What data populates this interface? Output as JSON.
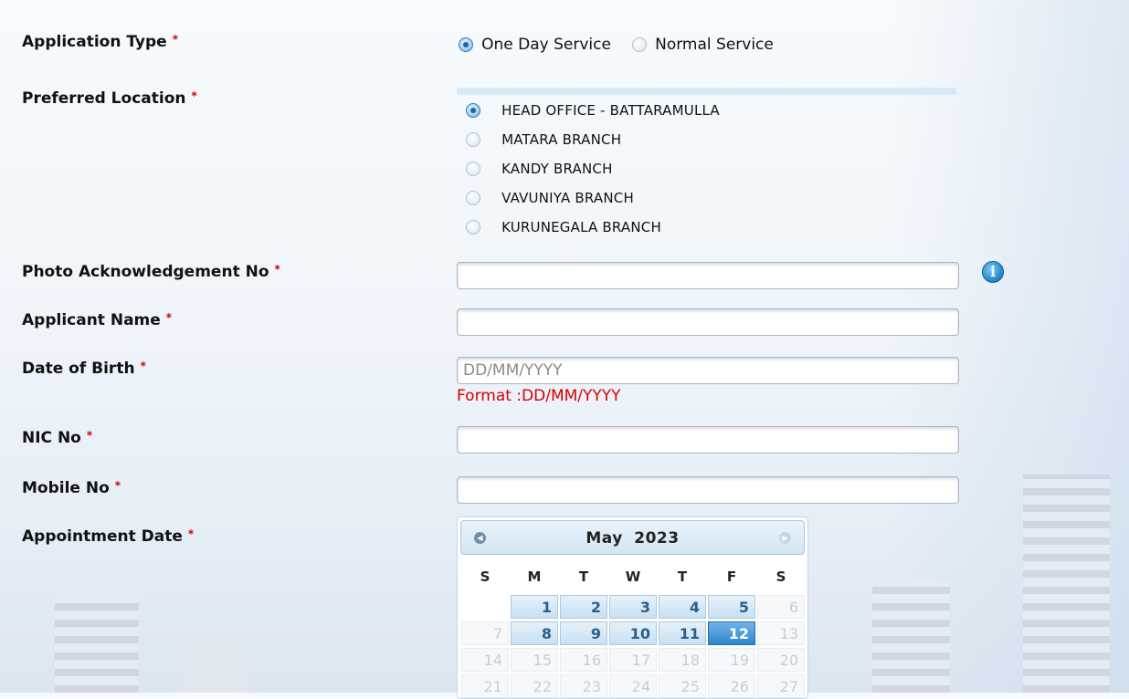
{
  "form": {
    "application_type": {
      "label": "Application Type",
      "options": [
        {
          "label": "One Day Service",
          "checked": true
        },
        {
          "label": "Normal Service",
          "checked": false
        }
      ]
    },
    "preferred_location": {
      "label": "Preferred Location",
      "options": [
        {
          "label": "HEAD OFFICE - BATTARAMULLA",
          "checked": true
        },
        {
          "label": "MATARA BRANCH",
          "checked": false
        },
        {
          "label": "KANDY BRANCH",
          "checked": false
        },
        {
          "label": "VAVUNIYA BRANCH",
          "checked": false
        },
        {
          "label": "KURUNEGALA BRANCH",
          "checked": false
        }
      ]
    },
    "photo_ack": {
      "label": "Photo Acknowledgement No",
      "value": ""
    },
    "applicant_name": {
      "label": "Applicant Name",
      "value": ""
    },
    "dob": {
      "label": "Date of Birth",
      "value": "",
      "placeholder": "DD/MM/YYYY",
      "hint": "Format :DD/MM/YYYY"
    },
    "nic": {
      "label": "NIC No",
      "value": ""
    },
    "mobile": {
      "label": "Mobile No",
      "value": ""
    },
    "appointment": {
      "label": "Appointment Date"
    },
    "required_mark": "*"
  },
  "calendar": {
    "month": "May",
    "year": "2023",
    "weekdays": [
      "S",
      "M",
      "T",
      "W",
      "T",
      "F",
      "S"
    ],
    "rows": [
      [
        "",
        "1",
        "2",
        "3",
        "4",
        "5",
        "6"
      ],
      [
        "7",
        "8",
        "9",
        "10",
        "11",
        "12",
        "13"
      ],
      [
        "14",
        "15",
        "16",
        "17",
        "18",
        "19",
        "20"
      ],
      [
        "21",
        "22",
        "23",
        "24",
        "25",
        "26",
        "27"
      ]
    ],
    "selected": "12"
  },
  "colors": {
    "accent": "#2f86cf",
    "required": "#cc0000",
    "hint": "#d40000"
  }
}
